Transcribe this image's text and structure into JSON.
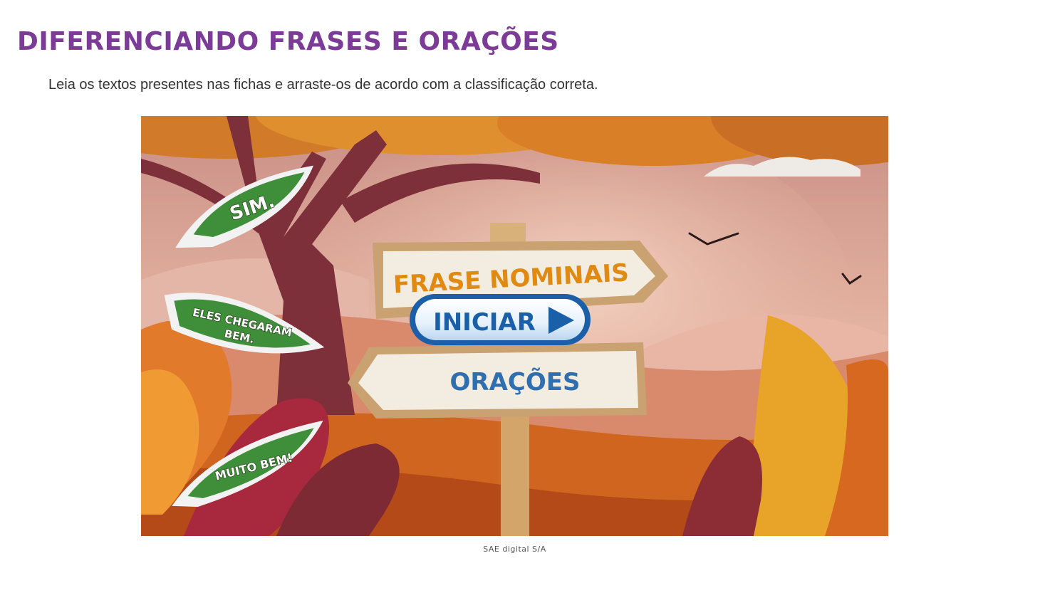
{
  "header": {
    "title": "DIFERENCIANDO FRASES E ORAÇÕES",
    "instructions": "Leia os textos presentes nas fichas e arraste-os de acordo com a classificação correta."
  },
  "game": {
    "leaves": [
      {
        "label": "SIM."
      },
      {
        "label_line1": "ELES CHEGARAM",
        "label_line2": "BEM."
      },
      {
        "label": "MUITO BEM!"
      }
    ],
    "signs": {
      "top": "FRASE NOMINAIS",
      "bottom": "ORAÇÕES"
    },
    "start_button": "INICIAR",
    "colors": {
      "sign_top_text": "#e08a12",
      "sign_bottom_text": "#2f6fb0",
      "button_blue": "#1a5fa8",
      "leaf_green": "#3f8f3a",
      "title_purple": "#7b3b96"
    }
  },
  "caption": "SAE digital S/A"
}
